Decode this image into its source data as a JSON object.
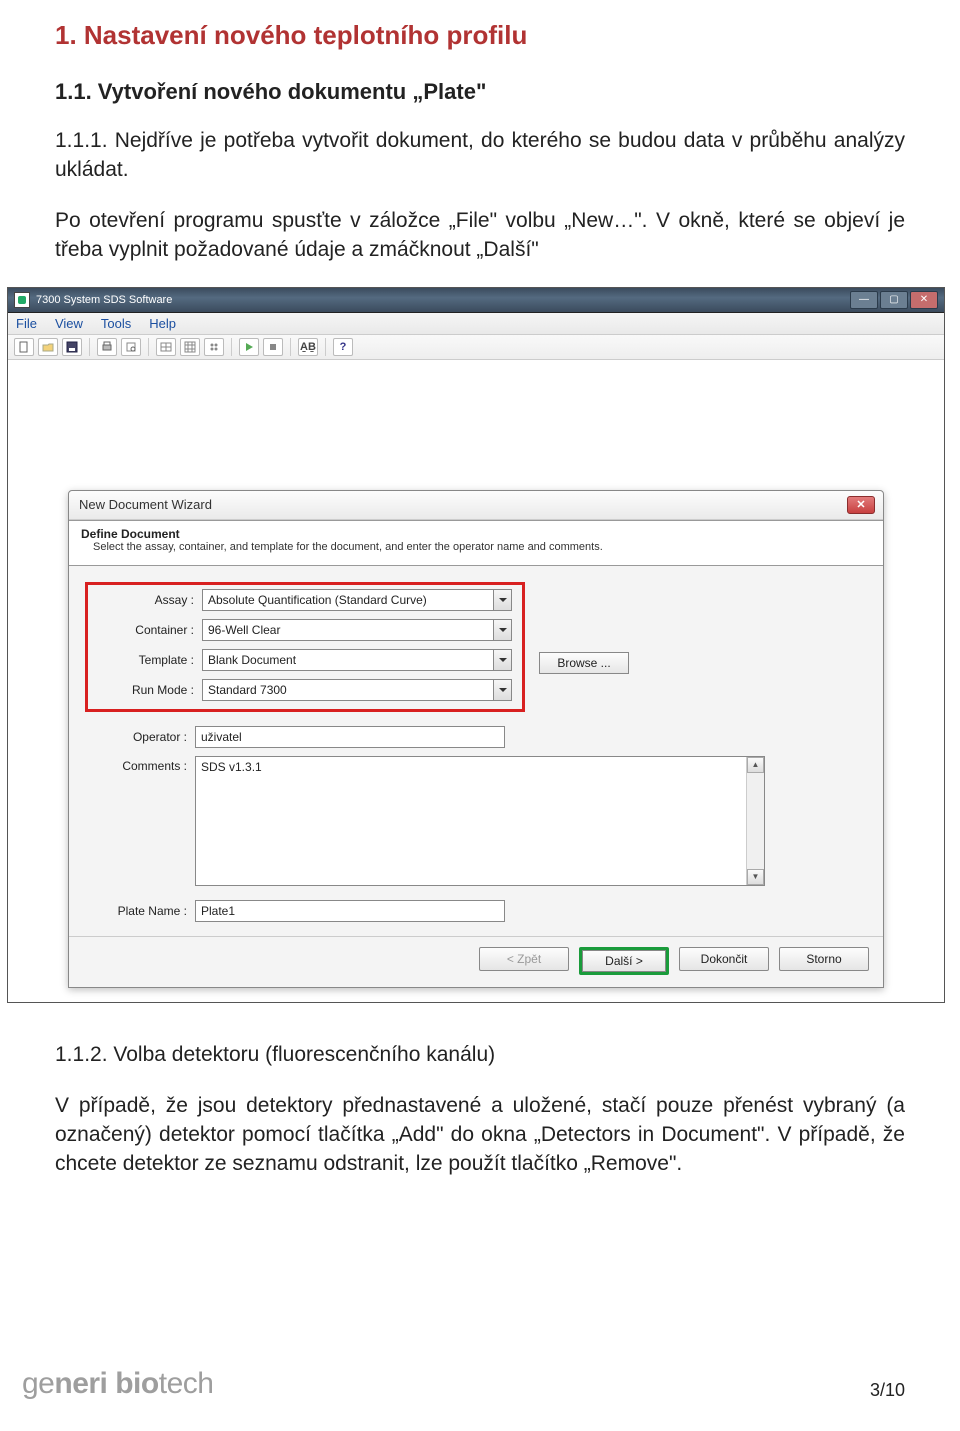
{
  "doc": {
    "h1": "1.  Nastavení nového teplotního profilu",
    "h2_1": "1.1.   Vytvoření nového dokumentu „Plate\"",
    "p111": "1.1.1.  Nejdříve je potřeba vytvořit dokument, do kterého se budou data v průběhu analýzy ukládat.",
    "p_open": "Po otevření programu spusťte v záložce „File\" volbu „New…\". V okně, které se objeví je třeba vyplnit požadované údaje a zmáčknout „Další\"",
    "h2_2": "1.1.2.  Volba detektoru (fluorescenčního kanálu)",
    "p112": "V případě, že jsou detektory přednastavené a uložené, stačí pouze přenést vybraný (a označený) detektor pomocí tlačítka „Add\" do okna „Detectors in Document\". V případě, že chcete detektor ze seznamu odstranit, lze použít tlačítko „Remove\"."
  },
  "app": {
    "title": "7300 System SDS Software",
    "menu": [
      "File",
      "View",
      "Tools",
      "Help"
    ]
  },
  "wizard": {
    "title": "New Document Wizard",
    "header_t": "Define Document",
    "header_s": "Select the assay, container, and template for the document, and enter the operator name and comments.",
    "labels": {
      "assay": "Assay :",
      "container": "Container :",
      "template": "Template :",
      "runmode": "Run Mode :",
      "operator": "Operator :",
      "comments": "Comments :",
      "platename": "Plate Name :"
    },
    "values": {
      "assay": "Absolute Quantification (Standard Curve)",
      "container": "96-Well Clear",
      "template": "Blank Document",
      "runmode": "Standard 7300",
      "operator": "uživatel",
      "comments": "SDS v1.3.1",
      "platename": "Plate1"
    },
    "browse": "Browse ...",
    "buttons": {
      "back": "< Zpět",
      "next": "Další >",
      "finish": "Dokončit",
      "cancel": "Storno"
    }
  },
  "footer": {
    "brand_ge": "ge",
    "brand_neri": "neri ",
    "brand_bio": "bio",
    "brand_tech": "tech",
    "page": "3/10"
  }
}
